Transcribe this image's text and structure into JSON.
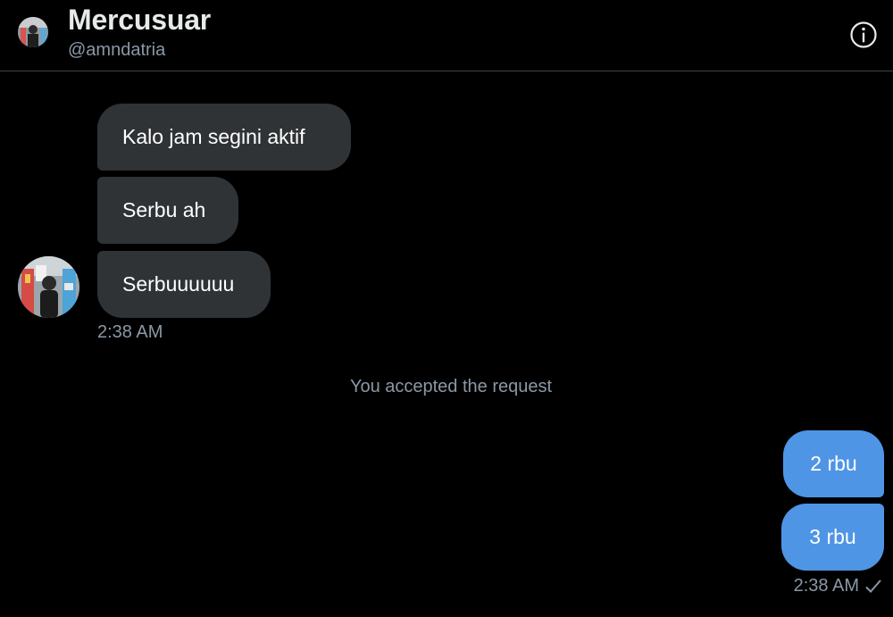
{
  "header": {
    "name": "Mercusuar",
    "handle": "@amndatria"
  },
  "conversation": {
    "received": [
      {
        "text": "Kalo jam segini aktif"
      },
      {
        "text": "Serbu ah"
      },
      {
        "text": "Serbuuuuuu"
      }
    ],
    "received_time": "2:38 AM",
    "system_message": "You accepted the request",
    "sent": [
      {
        "text": "2 rbu"
      },
      {
        "text": "3 rbu"
      }
    ],
    "sent_time": "2:38 AM"
  },
  "colors": {
    "background": "#000000",
    "received_bubble": "#2f3336",
    "sent_bubble": "#4f95e5",
    "secondary_text": "#8b98a5"
  }
}
